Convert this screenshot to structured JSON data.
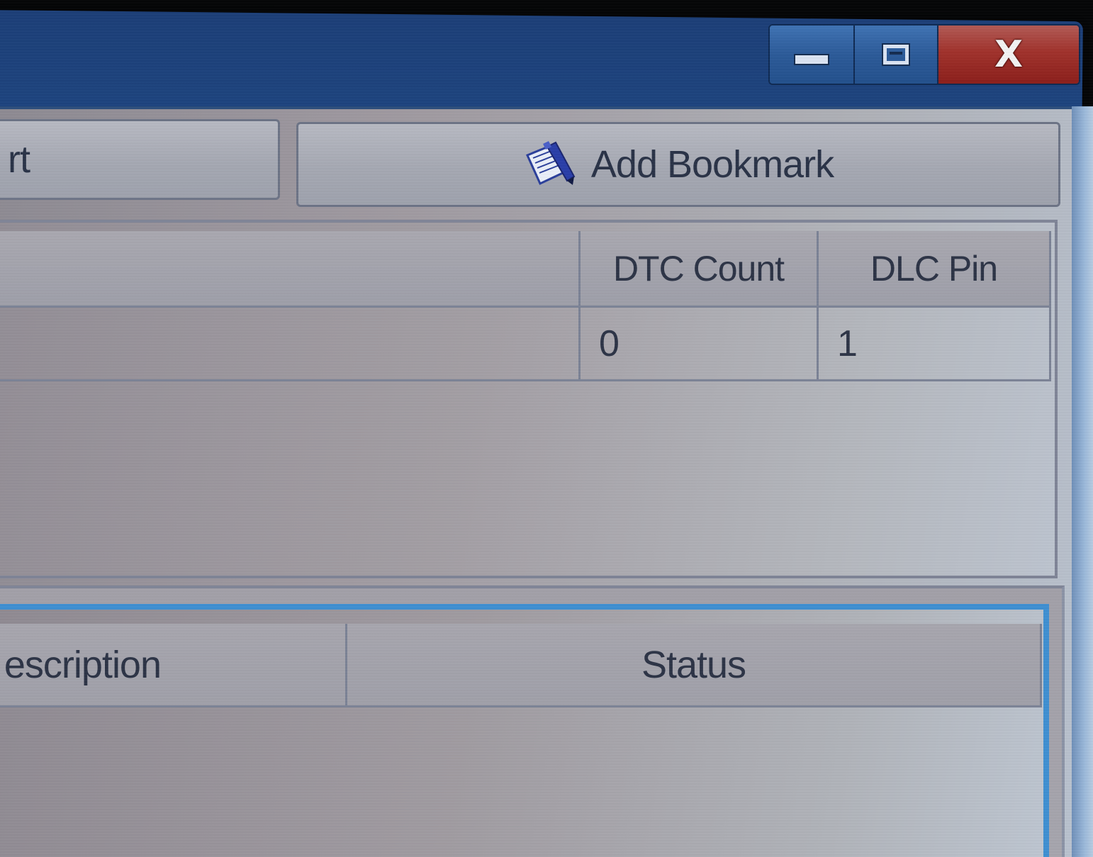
{
  "window": {
    "caption": {
      "minimize_icon": "minimize-icon",
      "maximize_icon": "maximize-icon",
      "close_label": "X"
    }
  },
  "toolbar": {
    "report_label": "rt",
    "bookmark_label": "Add Bookmark",
    "bookmark_icon": "bookmark-pen-icon"
  },
  "upper_table": {
    "columns": [
      "",
      "DTC Count",
      "DLC Pin"
    ],
    "rows": [
      [
        "",
        "0",
        "1"
      ]
    ]
  },
  "lower_table": {
    "columns": [
      "escription",
      "Status"
    ]
  },
  "colors": {
    "titlebar": "#204f8e",
    "close_button": "#a0322c",
    "panel_accent": "#3f8fd1",
    "text": "#2d3446"
  }
}
